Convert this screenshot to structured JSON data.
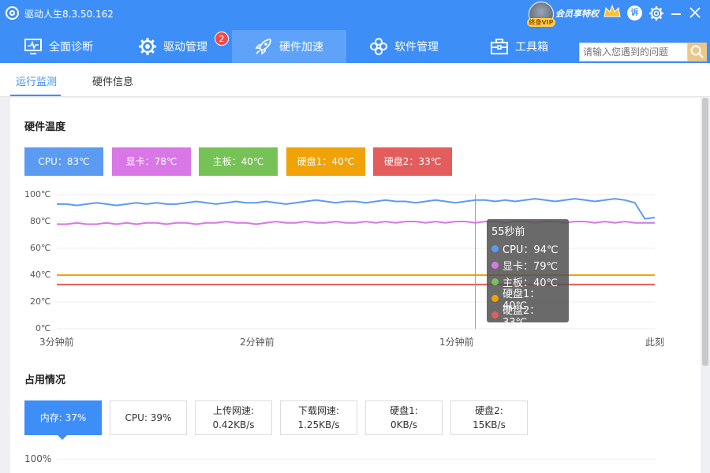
{
  "app": {
    "title": "驱动人生8.3.50.162",
    "vip_text": "会员享特权",
    "vip_badge": "终身VIP",
    "feedback_icon_text": "诉"
  },
  "nav": {
    "items": [
      {
        "label": "全面诊断",
        "icon": "monitor-icon"
      },
      {
        "label": "驱动管理",
        "icon": "gear-icon",
        "badge": "2"
      },
      {
        "label": "硬件加速",
        "icon": "rocket-icon",
        "active": true
      },
      {
        "label": "软件管理",
        "icon": "flower-icon"
      },
      {
        "label": "工具箱",
        "icon": "toolbox-icon"
      }
    ]
  },
  "search": {
    "placeholder": "请输入您遇到的问题"
  },
  "subtabs": {
    "monitor": "运行监测",
    "info": "硬件信息"
  },
  "temperature": {
    "title": "硬件温度",
    "chips": [
      {
        "label": "CPU：83℃",
        "color": "#5b9bf1"
      },
      {
        "label": "显卡：78℃",
        "color": "#d977e6"
      },
      {
        "label": "主板：40℃",
        "color": "#77c256"
      },
      {
        "label": "硬盘1：40℃",
        "color": "#f0a207"
      },
      {
        "label": "硬盘2：33℃",
        "color": "#e35d5d"
      }
    ]
  },
  "tooltip": {
    "time": "55秒前",
    "rows": [
      {
        "label": "CPU：94℃",
        "color": "#5b9bf1"
      },
      {
        "label": "显卡：79℃",
        "color": "#d977e6"
      },
      {
        "label": "主板：40℃",
        "color": "#77c256"
      },
      {
        "label": "硬盘1：40℃",
        "color": "#f0a207"
      },
      {
        "label": "硬盘2：33℃",
        "color": "#e35d5d"
      }
    ]
  },
  "usage": {
    "title": "占用情况",
    "cards": [
      {
        "line1": "内存: 37%",
        "line2": "",
        "active": true
      },
      {
        "line1": "CPU: 39%",
        "line2": ""
      },
      {
        "line1": "上传网速:",
        "line2": "0.42KB/s"
      },
      {
        "line1": "下载网速:",
        "line2": "1.25KB/s"
      },
      {
        "line1": "硬盘1:",
        "line2": "0KB/s"
      },
      {
        "line1": "硬盘2:",
        "line2": "15KB/s"
      }
    ],
    "axis_top": "100%"
  },
  "chart_data": {
    "type": "line",
    "ylim": [
      0,
      100
    ],
    "y_ticks": [
      "0℃",
      "20℃",
      "40℃",
      "60℃",
      "80℃",
      "100℃"
    ],
    "x_ticks": [
      "3分钟前",
      "2分钟前",
      "1分钟前",
      "此刻"
    ],
    "series": [
      {
        "name": "CPU",
        "color": "#5b9bf1",
        "values": [
          93,
          93,
          92,
          93,
          94,
          93,
          92,
          93,
          94,
          93,
          94,
          93,
          93,
          94,
          95,
          94,
          93,
          94,
          95,
          94,
          94,
          95,
          94,
          93,
          94,
          95,
          96,
          95,
          94,
          95,
          95,
          94,
          95,
          96,
          95,
          95,
          94,
          95,
          96,
          95,
          94,
          95,
          96,
          96,
          95,
          96,
          95,
          96,
          97,
          96,
          95,
          96,
          97,
          96,
          95,
          96,
          97,
          96,
          94,
          82,
          83
        ]
      },
      {
        "name": "显卡",
        "color": "#d977e6",
        "values": [
          78,
          78,
          79,
          78,
          78,
          79,
          78,
          79,
          78,
          79,
          79,
          78,
          79,
          79,
          78,
          79,
          79,
          80,
          79,
          79,
          78,
          79,
          80,
          79,
          79,
          80,
          79,
          79,
          80,
          79,
          79,
          80,
          79,
          80,
          79,
          80,
          80,
          79,
          80,
          79,
          80,
          80,
          79,
          80,
          80,
          79,
          80,
          80,
          79,
          80,
          80,
          79,
          80,
          80,
          79,
          80,
          79,
          80,
          79,
          79,
          79
        ]
      },
      {
        "name": "主板",
        "color": "#77c256",
        "values": [
          40,
          40,
          40,
          40,
          40,
          40,
          40,
          40,
          40,
          40,
          40,
          40,
          40,
          40,
          40,
          40,
          40,
          40,
          40,
          40,
          40,
          40,
          40,
          40,
          40,
          40,
          40,
          40,
          40,
          40,
          40,
          40,
          40,
          40,
          40,
          40,
          40,
          40,
          40,
          40,
          40,
          40,
          40,
          40,
          40,
          40,
          40,
          40,
          40,
          40,
          40,
          40,
          40,
          40,
          40,
          40,
          40,
          40,
          40,
          40,
          40
        ]
      },
      {
        "name": "硬盘1",
        "color": "#f0a207",
        "values": [
          40,
          40,
          40,
          40,
          40,
          40,
          40,
          40,
          40,
          40,
          40,
          40,
          40,
          40,
          40,
          40,
          40,
          40,
          40,
          40,
          40,
          40,
          40,
          40,
          40,
          40,
          40,
          40,
          40,
          40,
          40,
          40,
          40,
          40,
          40,
          40,
          40,
          40,
          40,
          40,
          40,
          40,
          40,
          40,
          40,
          40,
          40,
          40,
          40,
          40,
          40,
          40,
          40,
          40,
          40,
          40,
          40,
          40,
          40,
          40,
          40
        ]
      },
      {
        "name": "硬盘2",
        "color": "#e35d5d",
        "values": [
          33,
          33,
          33,
          33,
          33,
          33,
          33,
          33,
          33,
          33,
          33,
          33,
          33,
          33,
          33,
          33,
          33,
          33,
          33,
          33,
          33,
          33,
          33,
          33,
          33,
          33,
          33,
          33,
          33,
          33,
          33,
          33,
          33,
          33,
          33,
          33,
          33,
          33,
          33,
          33,
          33,
          33,
          33,
          33,
          33,
          33,
          33,
          33,
          33,
          33,
          33,
          33,
          33,
          33,
          33,
          33,
          33,
          33,
          33,
          33,
          33
        ]
      }
    ],
    "cursor_index": 42
  }
}
